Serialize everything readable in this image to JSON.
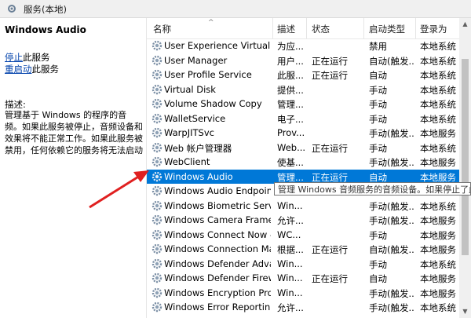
{
  "window": {
    "title": "服务(本地)"
  },
  "left_panel": {
    "service_name": "Windows Audio",
    "stop_link": "停止",
    "stop_suffix": "此服务",
    "restart_link": "重启动",
    "restart_suffix": "此服务",
    "desc_label": "描述:",
    "desc_text": "管理基于 Windows 的程序的音频。如果此服务被停止，音频设备和效果将不能正常工作。如果此服务被禁用，任何依赖它的服务将无法启动"
  },
  "columns": [
    "名称",
    "描述",
    "状态",
    "启动类型",
    "登录为"
  ],
  "rows": [
    {
      "name": "User Experience Virtualiz...",
      "desc": "为应...",
      "status": "",
      "startup": "禁用",
      "logon": "本地系统"
    },
    {
      "name": "User Manager",
      "desc": "用户...",
      "status": "正在运行",
      "startup": "自动(触发...",
      "logon": "本地系统"
    },
    {
      "name": "User Profile Service",
      "desc": "此服...",
      "status": "正在运行",
      "startup": "自动",
      "logon": "本地系统"
    },
    {
      "name": "Virtual Disk",
      "desc": "提供...",
      "status": "",
      "startup": "手动",
      "logon": "本地系统"
    },
    {
      "name": "Volume Shadow Copy",
      "desc": "管理...",
      "status": "",
      "startup": "手动",
      "logon": "本地系统"
    },
    {
      "name": "WalletService",
      "desc": "电子...",
      "status": "",
      "startup": "手动",
      "logon": "本地系统"
    },
    {
      "name": "WarpJITSvc",
      "desc": "Prov...",
      "status": "",
      "startup": "手动(触发...",
      "logon": "本地服务"
    },
    {
      "name": "Web 帐户管理器",
      "desc": "Web...",
      "status": "正在运行",
      "startup": "手动",
      "logon": "本地系统"
    },
    {
      "name": "WebClient",
      "desc": "使基...",
      "status": "",
      "startup": "手动(触发...",
      "logon": "本地服务"
    },
    {
      "name": "Windows Audio",
      "desc": "管理...",
      "status": "正在运行",
      "startup": "自动",
      "logon": "本地服务"
    },
    {
      "name": "Windows Audio Endpoint...",
      "desc": "",
      "status": "",
      "startup": "",
      "logon": ""
    },
    {
      "name": "Windows Biometric Servi...",
      "desc": "Win...",
      "status": "",
      "startup": "手动(触发...",
      "logon": "本地系统"
    },
    {
      "name": "Windows Camera Frame ...",
      "desc": "允许...",
      "status": "",
      "startup": "手动(触发...",
      "logon": "本地服务"
    },
    {
      "name": "Windows Connect Now -...",
      "desc": "WC...",
      "status": "",
      "startup": "手动",
      "logon": "本地服务"
    },
    {
      "name": "Windows Connection Ma...",
      "desc": "根据...",
      "status": "正在运行",
      "startup": "自动(触发...",
      "logon": "本地服务"
    },
    {
      "name": "Windows Defender Adva...",
      "desc": "Win...",
      "status": "",
      "startup": "手动",
      "logon": "本地系统"
    },
    {
      "name": "Windows Defender Firew...",
      "desc": "Win...",
      "status": "正在运行",
      "startup": "自动",
      "logon": "本地服务"
    },
    {
      "name": "Windows Encryption Pro...",
      "desc": "Win...",
      "status": "",
      "startup": "手动(触发...",
      "logon": "本地服务"
    },
    {
      "name": "Windows Error Reportin...",
      "desc": "允许...",
      "status": "",
      "startup": "手动(触发...",
      "logon": "本地系统"
    }
  ],
  "selected_row": 9,
  "tooltip": "管理 Windows 音频服务的音频设备。如果停止了此",
  "colors": {
    "selection": "#0078d7",
    "link": "#0645ad",
    "arrow": "#e02020"
  },
  "icons": {
    "row": "gear-icon",
    "title": "services-icon"
  }
}
